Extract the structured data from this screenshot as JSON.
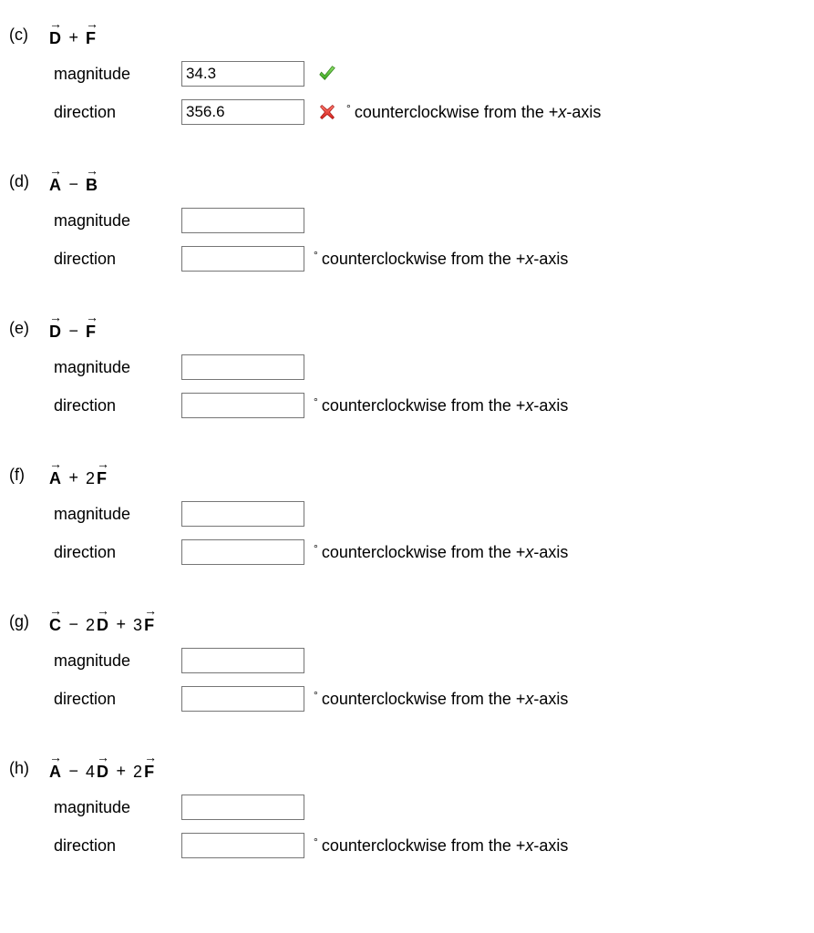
{
  "labels": {
    "magnitude": "magnitude",
    "direction": "direction",
    "deg_ccw_prefix": "°",
    "ccw_text_1": " counterclockwise from the +",
    "ccw_text_x": "x",
    "ccw_text_2": "-axis"
  },
  "problems": [
    {
      "id": "c",
      "label": "(c)",
      "expr": [
        {
          "type": "vec",
          "sym": "D"
        },
        {
          "type": "op",
          "sym": "+"
        },
        {
          "type": "vec",
          "sym": "F"
        }
      ],
      "magnitude": {
        "value": "34.3",
        "status": "correct"
      },
      "direction": {
        "value": "356.6",
        "status": "wrong"
      }
    },
    {
      "id": "d",
      "label": "(d)",
      "expr": [
        {
          "type": "vec",
          "sym": "A"
        },
        {
          "type": "op",
          "sym": "−"
        },
        {
          "type": "vec",
          "sym": "B"
        }
      ],
      "magnitude": {
        "value": "",
        "status": "none"
      },
      "direction": {
        "value": "",
        "status": "none"
      }
    },
    {
      "id": "e",
      "label": "(e)",
      "expr": [
        {
          "type": "vec",
          "sym": "D"
        },
        {
          "type": "op",
          "sym": "−"
        },
        {
          "type": "vec",
          "sym": "F"
        }
      ],
      "magnitude": {
        "value": "",
        "status": "none"
      },
      "direction": {
        "value": "",
        "status": "none"
      }
    },
    {
      "id": "f",
      "label": "(f)",
      "expr": [
        {
          "type": "vec",
          "sym": "A"
        },
        {
          "type": "op",
          "sym": "+"
        },
        {
          "type": "coef",
          "sym": "2"
        },
        {
          "type": "vec",
          "sym": "F"
        }
      ],
      "magnitude": {
        "value": "",
        "status": "none"
      },
      "direction": {
        "value": "",
        "status": "none"
      }
    },
    {
      "id": "g",
      "label": "(g)",
      "expr": [
        {
          "type": "vec",
          "sym": "C"
        },
        {
          "type": "op",
          "sym": "−"
        },
        {
          "type": "coef",
          "sym": "2"
        },
        {
          "type": "vec",
          "sym": "D"
        },
        {
          "type": "op",
          "sym": "+"
        },
        {
          "type": "coef",
          "sym": "3"
        },
        {
          "type": "vec",
          "sym": "F"
        }
      ],
      "magnitude": {
        "value": "",
        "status": "none"
      },
      "direction": {
        "value": "",
        "status": "none"
      }
    },
    {
      "id": "h",
      "label": "(h)",
      "expr": [
        {
          "type": "vec",
          "sym": "A"
        },
        {
          "type": "op",
          "sym": "−"
        },
        {
          "type": "coef",
          "sym": "4"
        },
        {
          "type": "vec",
          "sym": "D"
        },
        {
          "type": "op",
          "sym": "+"
        },
        {
          "type": "coef",
          "sym": "2"
        },
        {
          "type": "vec",
          "sym": "F"
        }
      ],
      "magnitude": {
        "value": "",
        "status": "none"
      },
      "direction": {
        "value": "",
        "status": "none"
      }
    }
  ]
}
